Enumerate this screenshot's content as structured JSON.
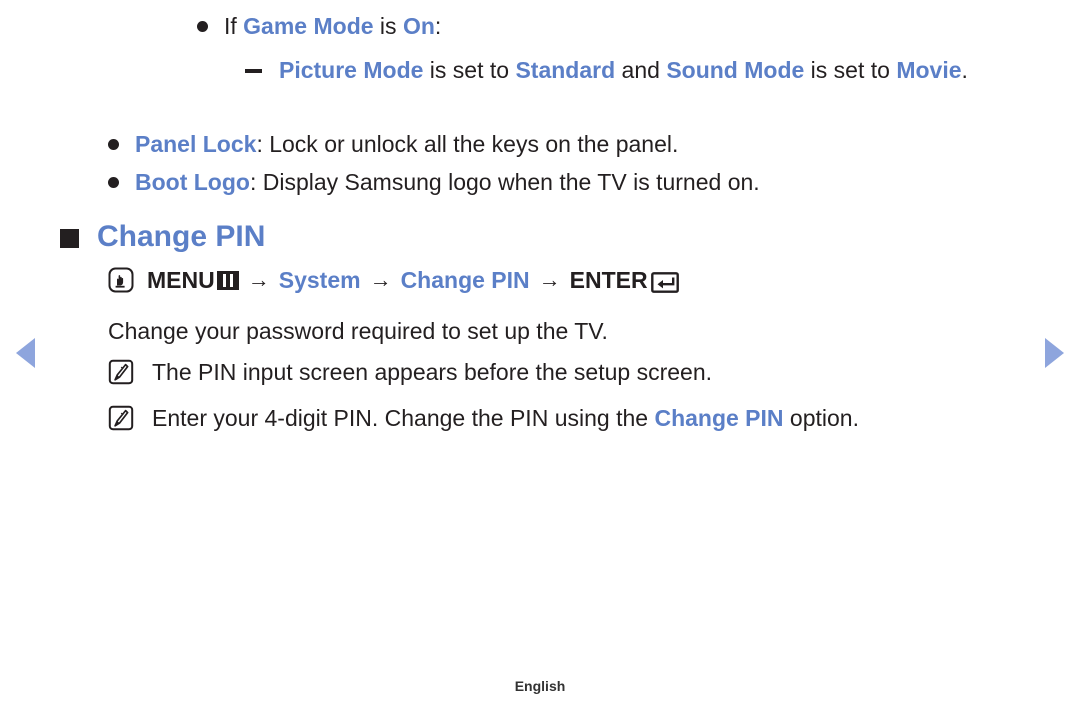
{
  "page": {
    "footer_label": "English"
  },
  "nav": {
    "prev_label": "previous page",
    "next_label": "next page"
  },
  "bullets": {
    "game_mode": {
      "pre": "If ",
      "term1": "Game Mode",
      "mid": " is ",
      "term2": "On",
      "post": ":"
    },
    "picture_mode": {
      "term1": "Picture Mode",
      "mid1": " is set to ",
      "term2": "Standard",
      "mid2": " and ",
      "term3": "Sound Mode",
      "mid3": " is set to ",
      "term4": "Movie",
      "post": "."
    },
    "panel_lock": {
      "term": "Panel Lock",
      "rest": ": Lock or unlock all the keys on the panel."
    },
    "boot_logo": {
      "term": "Boot Logo",
      "rest": ": Display Samsung logo when the TV is turned on."
    }
  },
  "section": {
    "heading": "Change PIN",
    "menu_path": {
      "menu_label": "MENU",
      "arrow": "→",
      "step2": "System",
      "step3": "Change PIN",
      "enter_label": "ENTER"
    },
    "description": "Change your password required to set up the TV.",
    "notes": [
      {
        "text": "The PIN input screen appears before the setup screen."
      },
      {
        "pre": "Enter your 4-digit PIN. Change the PIN using the ",
        "term": "Change PIN",
        "post": " option."
      }
    ]
  },
  "colors": {
    "accent_blue": "#5b7fc7",
    "nav_arrow_blue": "#8ea5dd",
    "body_text": "#231f20"
  },
  "icons": {
    "hand_press": "hand-press-icon",
    "menu_grid": "menu-grid-icon",
    "enter_return": "enter-return-icon",
    "note_pencil": "note-pencil-icon",
    "nav_prev": "triangle-left-icon",
    "nav_next": "triangle-right-icon"
  }
}
